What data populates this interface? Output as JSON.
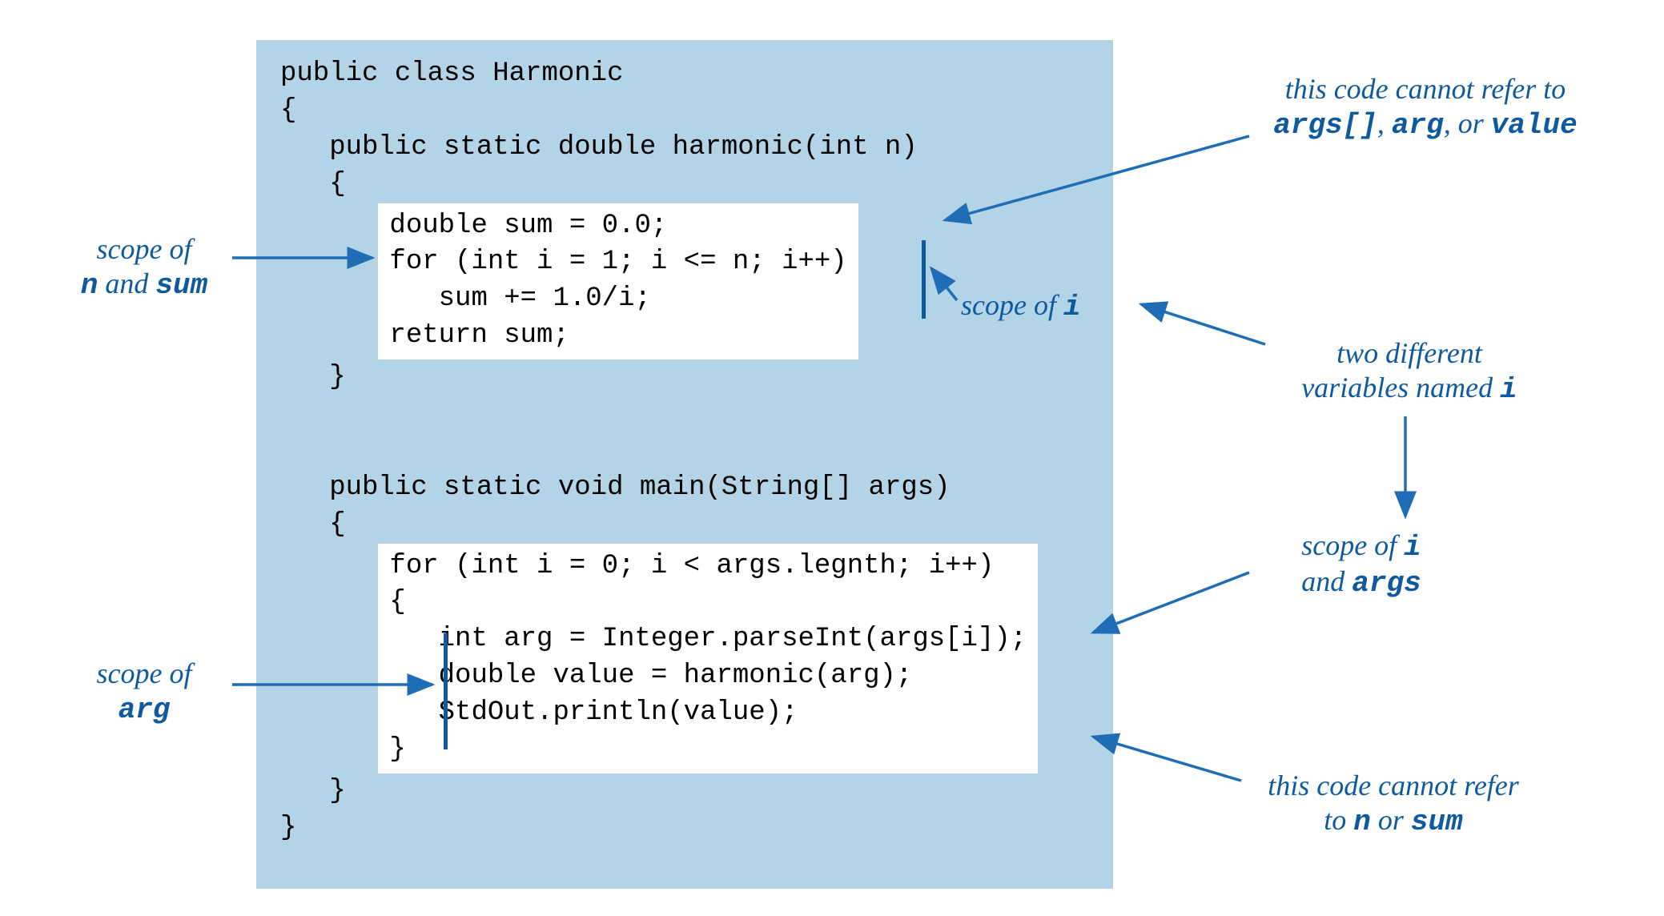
{
  "code": {
    "line1": "public class Harmonic",
    "line2": "{",
    "line3": "   public static double harmonic(int n)",
    "line4": "   {",
    "box1_l1": "double sum = 0.0;",
    "box1_l2": "for (int i = 1; i <= n; i++)",
    "box1_l3": "   sum += 1.0/i;",
    "box1_l4": "return sum;",
    "line5": "   }",
    "line6": "   public static void main(String[] args)",
    "line7": "   {",
    "box2_l1": "for (int i = 0; i < args.legnth; i++)",
    "box2_l2": "{",
    "box2_l3": "   int arg = Integer.parseInt(args[i]);",
    "box2_l4": "   double value = harmonic(arg);",
    "box2_l5": "   StdOut.println(value);",
    "box2_l6": "}",
    "line8": "   }",
    "line9": "}"
  },
  "labels": {
    "scope_n_sum_1": "scope of",
    "scope_n_sum_2a": "n",
    "scope_n_sum_2b": " and ",
    "scope_n_sum_2c": "sum",
    "scope_arg_1": "scope of",
    "scope_arg_2": "arg",
    "scope_i_1a": "scope of ",
    "scope_i_1b": "i",
    "cannot_args_1": "this code cannot refer to",
    "cannot_args_2a": "args[]",
    "cannot_args_2b": ", ",
    "cannot_args_2c": "arg",
    "cannot_args_2d": ", or ",
    "cannot_args_2e": "value",
    "two_i_1": "two different",
    "two_i_2a": "variables named ",
    "two_i_2b": "i",
    "scope_i_args_1a": "scope of ",
    "scope_i_args_1b": "i",
    "scope_i_args_2a": "and ",
    "scope_i_args_2b": "args",
    "cannot_n_1": "this code cannot refer",
    "cannot_n_2a": "to ",
    "cannot_n_2b": "n",
    "cannot_n_2c": " or ",
    "cannot_n_2d": "sum"
  }
}
